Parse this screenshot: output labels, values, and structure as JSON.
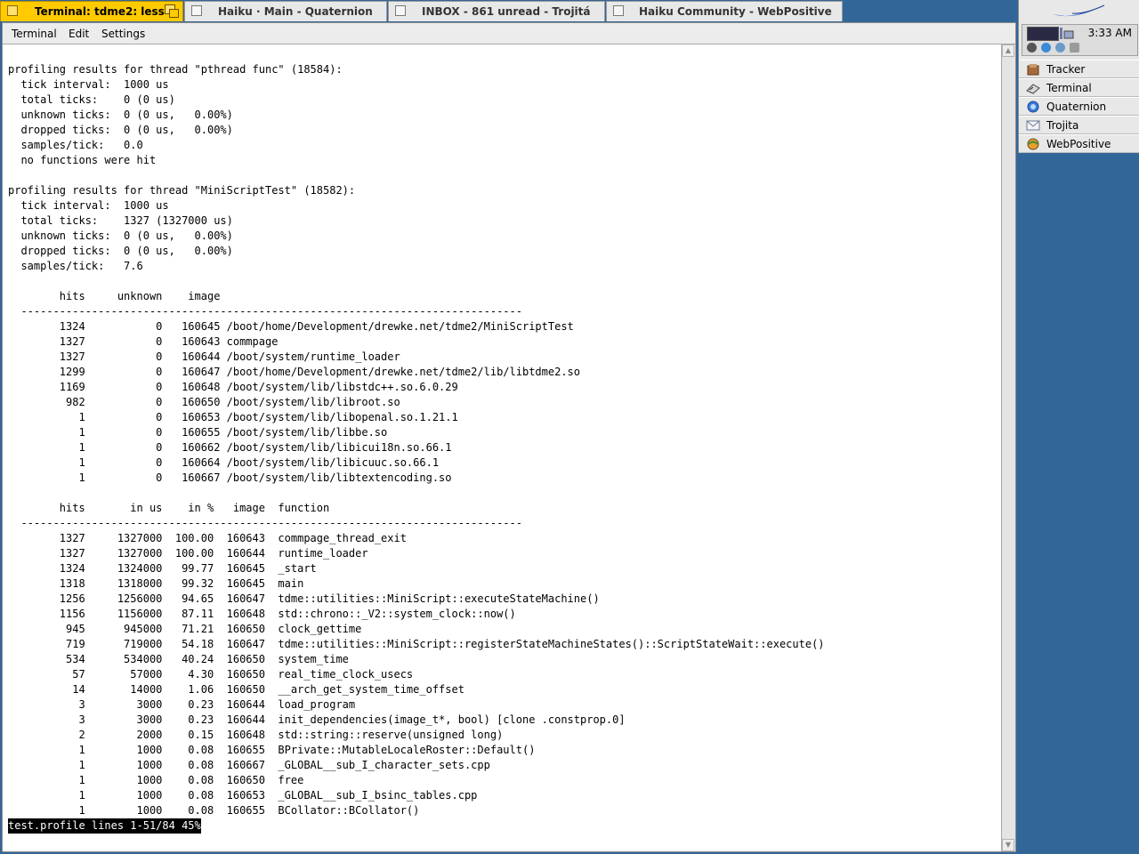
{
  "tabs": [
    {
      "title": "Terminal: tdme2: less",
      "active": true
    },
    {
      "title": "Haiku · Main - Quaternion",
      "active": false
    },
    {
      "title": "INBOX - 861 unread - Trojitá",
      "active": false
    },
    {
      "title": "Haiku Community - WebPositive",
      "active": false
    }
  ],
  "menu": {
    "terminal": "Terminal",
    "edit": "Edit",
    "settings": "Settings"
  },
  "terminal_lines": [
    "profiling results for thread \"pthread func\" (18584):",
    "  tick interval:  1000 us",
    "  total ticks:    0 (0 us)",
    "  unknown ticks:  0 (0 us,   0.00%)",
    "  dropped ticks:  0 (0 us,   0.00%)",
    "  samples/tick:   0.0",
    "  no functions were hit",
    "",
    "profiling results for thread \"MiniScriptTest\" (18582):",
    "  tick interval:  1000 us",
    "  total ticks:    1327 (1327000 us)",
    "  unknown ticks:  0 (0 us,   0.00%)",
    "  dropped ticks:  0 (0 us,   0.00%)",
    "  samples/tick:   7.6",
    "",
    "        hits     unknown    image",
    "  ------------------------------------------------------------------------------",
    "        1324           0   160645 /boot/home/Development/drewke.net/tdme2/MiniScriptTest",
    "        1327           0   160643 commpage",
    "        1327           0   160644 /boot/system/runtime_loader",
    "        1299           0   160647 /boot/home/Development/drewke.net/tdme2/lib/libtdme2.so",
    "        1169           0   160648 /boot/system/lib/libstdc++.so.6.0.29",
    "         982           0   160650 /boot/system/lib/libroot.so",
    "           1           0   160653 /boot/system/lib/libopenal.so.1.21.1",
    "           1           0   160655 /boot/system/lib/libbe.so",
    "           1           0   160662 /boot/system/lib/libicui18n.so.66.1",
    "           1           0   160664 /boot/system/lib/libicuuc.so.66.1",
    "           1           0   160667 /boot/system/lib/libtextencoding.so",
    "",
    "        hits       in us    in %   image  function",
    "  ------------------------------------------------------------------------------",
    "        1327     1327000  100.00  160643  commpage_thread_exit",
    "        1327     1327000  100.00  160644  runtime_loader",
    "        1324     1324000   99.77  160645  _start",
    "        1318     1318000   99.32  160645  main",
    "        1256     1256000   94.65  160647  tdme::utilities::MiniScript::executeStateMachine()",
    "        1156     1156000   87.11  160648  std::chrono::_V2::system_clock::now()",
    "         945      945000   71.21  160650  clock_gettime",
    "         719      719000   54.18  160647  tdme::utilities::MiniScript::registerStateMachineStates()::ScriptStateWait::execute()",
    "         534      534000   40.24  160650  system_time",
    "          57       57000    4.30  160650  real_time_clock_usecs",
    "          14       14000    1.06  160650  __arch_get_system_time_offset",
    "           3        3000    0.23  160644  load_program",
    "           3        3000    0.23  160644  init_dependencies(image_t*, bool) [clone .constprop.0]",
    "           2        2000    0.15  160648  std::string::reserve(unsigned long)",
    "           1        1000    0.08  160655  BPrivate::MutableLocaleRoster::Default()",
    "           1        1000    0.08  160667  _GLOBAL__sub_I_character_sets.cpp",
    "           1        1000    0.08  160650  free",
    "           1        1000    0.08  160653  _GLOBAL__sub_I_bsinc_tables.cpp",
    "           1        1000    0.08  160655  BCollator::BCollator()"
  ],
  "status_line": "test.profile lines 1-51/84 45%",
  "deskbar": {
    "clock": "3:33 AM",
    "apps": [
      {
        "label": "Tracker",
        "icon": "tracker-icon"
      },
      {
        "label": "Terminal",
        "icon": "terminal-icon"
      },
      {
        "label": "Quaternion",
        "icon": "quaternion-icon"
      },
      {
        "label": "Trojita",
        "icon": "trojita-icon"
      },
      {
        "label": "WebPositive",
        "icon": "webpositive-icon"
      }
    ]
  },
  "colors": {
    "desktop": "#336698",
    "active_tab": "#ffcb00",
    "inactive_tab": "#e8e8e8",
    "status_bg": "#000000"
  }
}
